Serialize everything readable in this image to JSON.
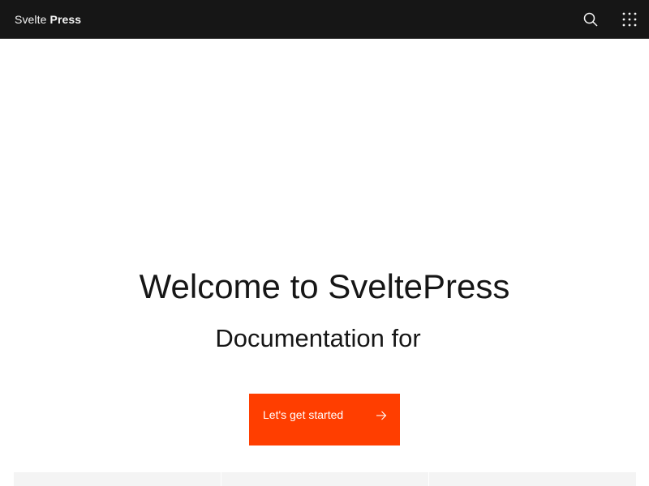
{
  "header": {
    "brand_prefix": "Svelte",
    "brand_name": "Press",
    "search_icon": "search-icon",
    "app_switcher_icon": "app-switcher-icon",
    "background": "#161616"
  },
  "hero": {
    "title": "Welcome to SveltePress",
    "tagline": "Documentation for",
    "cta_label": "Let's get started",
    "cta_icon": "arrow-right-icon",
    "cta_color": "#ff3e00"
  },
  "cards": [
    {
      "name": "card-1"
    },
    {
      "name": "card-2"
    },
    {
      "name": "card-3"
    }
  ]
}
